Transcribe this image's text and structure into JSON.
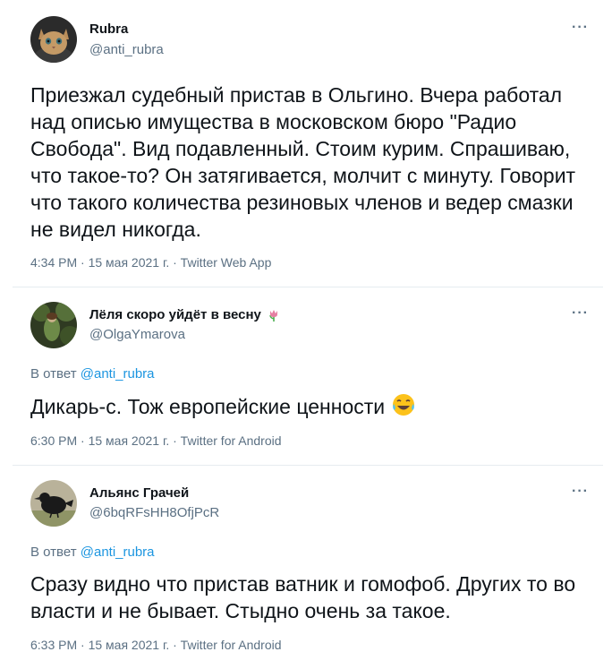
{
  "tweets": [
    {
      "name": "Rubra",
      "handle": "@anti_rubra",
      "more": "···",
      "text": "Приезжал судебный пристав в Ольгино. Вчера работал над описью имущества в московском бюро \"Радио Свобода\". Вид подавленный. Стоим курим. Спрашиваю, что такое-то? Он затягивается, молчит с минуту. Говорит что такого количества резиновых членов и ведер смазки не видел никогда.",
      "meta": "4:34 PM · 15 мая 2021 г. · Twitter Web App",
      "avatar_icon": "cat-avatar"
    },
    {
      "name": "Лёля скоро уйдёт в весну",
      "name_emoji": "tulip-icon",
      "handle": "@OlgaYmarova",
      "more": "···",
      "reply_prefix": "В ответ",
      "reply_handle": "@anti_rubra",
      "text": "Дикарь-с. Тож европейские ценности",
      "text_emoji": "laughing-tears-emoji",
      "meta": "6:30 PM · 15 мая 2021 г. · Twitter for Android",
      "avatar_icon": "forest-avatar"
    },
    {
      "name": "Альянс Грачей",
      "handle": "@6bqRFsHH8OfjPcR",
      "more": "···",
      "reply_prefix": "В ответ",
      "reply_handle": "@anti_rubra",
      "text": "Сразу видно что пристав ватник и гомофоб. Других то во власти и не бывает. Стыдно очень за такое.",
      "meta": "6:33 PM · 15 мая 2021 г. · Twitter for Android",
      "avatar_icon": "crow-avatar"
    }
  ],
  "colors": {
    "text": "#0f1419",
    "secondary": "#5b7083",
    "link": "#1b95e0",
    "divider": "#e6ecf0"
  }
}
